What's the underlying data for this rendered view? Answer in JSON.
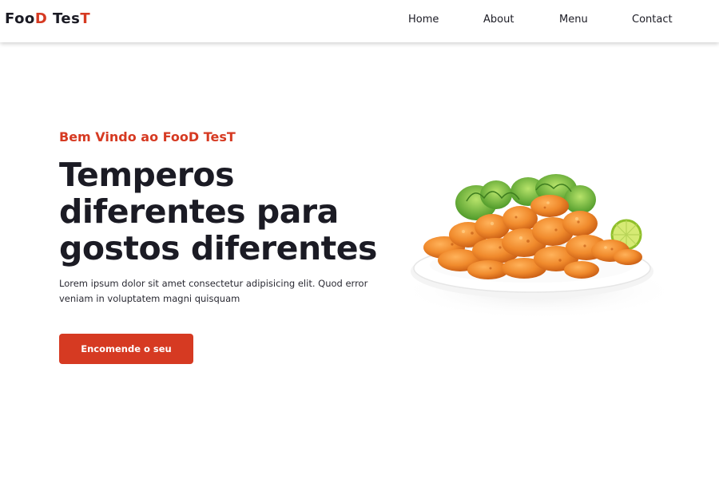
{
  "brand": {
    "part1": "Foo",
    "part2": "D",
    "part3": " Tes",
    "part4": "T"
  },
  "nav": {
    "items": [
      {
        "label": "Home"
      },
      {
        "label": "About"
      },
      {
        "label": "Menu"
      },
      {
        "label": "Contact"
      }
    ]
  },
  "hero": {
    "subtitle": "Bem Vindo ao FooD TesT",
    "title_lines": [
      "Temperos",
      "diferentes para",
      "gostos diferentes"
    ],
    "description": "Lorem ipsum dolor sit amet consectetur adipisicing elit. Quod error veniam in voluptatem magni quisquam",
    "cta_label": "Encomende o seu"
  },
  "colors": {
    "accent": "#d63a22",
    "text": "#1b1b24",
    "background": "#ffffff"
  },
  "image": {
    "subject": "plate-of-fried-chicken-with-lettuce-and-lime"
  }
}
